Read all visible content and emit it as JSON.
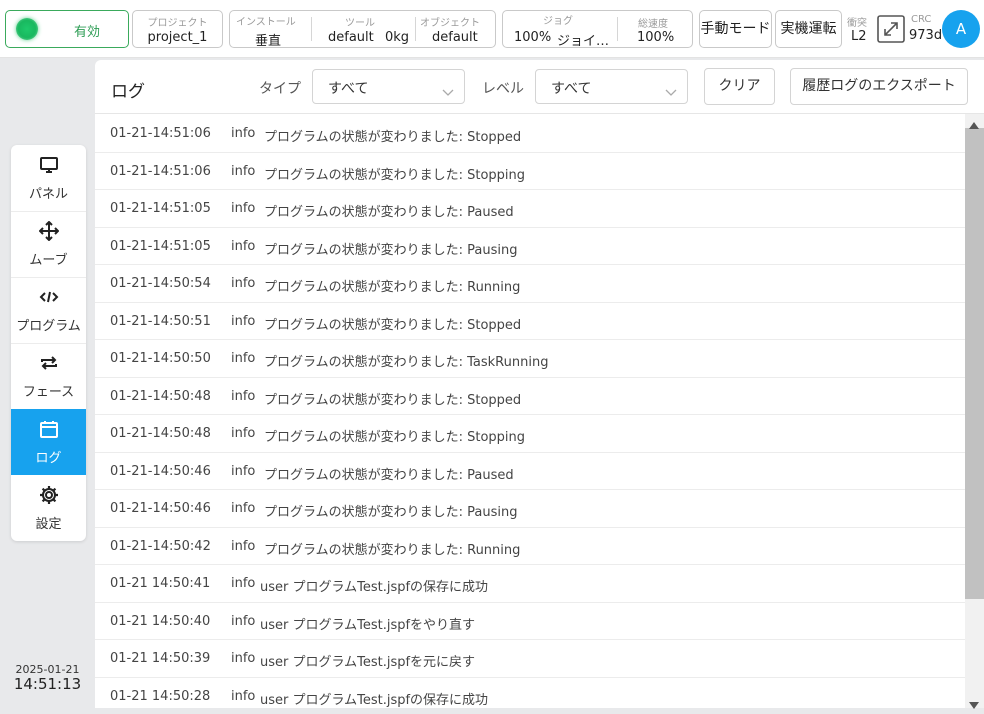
{
  "status": {
    "enable_label": "有効"
  },
  "project": {
    "label": "プロジェクト",
    "value": "project_1"
  },
  "install": {
    "install_label": "インストール",
    "install_value": "垂直",
    "tool_label": "ツール",
    "tool_value": "default",
    "tool_weight": "0kg",
    "object_label": "オブジェクト",
    "object_value": "default"
  },
  "jog": {
    "jog_label": "ジョグ",
    "jog_value": "100%",
    "jog_mode": "ジョイ…",
    "speed_label": "総速度",
    "speed_value": "100%"
  },
  "mode_buttons": {
    "manual": "手動モード",
    "real": "実機運転"
  },
  "collision": {
    "label": "衝突",
    "value": "L2"
  },
  "crc": {
    "label": "CRC",
    "value": "973d"
  },
  "user": {
    "avatar": "A"
  },
  "sidebar": {
    "items": [
      {
        "label": "パネル",
        "icon": "monitor-icon"
      },
      {
        "label": "ムーブ",
        "icon": "move-icon"
      },
      {
        "label": "プログラム",
        "icon": "code-icon"
      },
      {
        "label": "フェース",
        "icon": "repeat-icon"
      },
      {
        "label": "ログ",
        "icon": "calendar-icon"
      },
      {
        "label": "設定",
        "icon": "gear-icon"
      }
    ],
    "active": "ログ"
  },
  "clock": {
    "date": "2025-01-21",
    "time": "14:51:13"
  },
  "log_panel": {
    "title": "ログ",
    "type_label": "タイプ",
    "type_value": "すべて",
    "level_label": "レベル",
    "level_value": "すべて",
    "clear_button": "クリア",
    "export_button": "履歴ログのエクスポート"
  },
  "logs": [
    {
      "time": "01-21-14:51:06",
      "level": "info",
      "message": "プログラムの状態が変わりました: Stopped"
    },
    {
      "time": "01-21-14:51:06",
      "level": "info",
      "message": "プログラムの状態が変わりました: Stopping"
    },
    {
      "time": "01-21-14:51:05",
      "level": "info",
      "message": "プログラムの状態が変わりました: Paused"
    },
    {
      "time": "01-21-14:51:05",
      "level": "info",
      "message": "プログラムの状態が変わりました: Pausing"
    },
    {
      "time": "01-21-14:50:54",
      "level": "info",
      "message": "プログラムの状態が変わりました: Running"
    },
    {
      "time": "01-21-14:50:51",
      "level": "info",
      "message": "プログラムの状態が変わりました: Stopped"
    },
    {
      "time": "01-21-14:50:50",
      "level": "info",
      "message": "プログラムの状態が変わりました: TaskRunning"
    },
    {
      "time": "01-21-14:50:48",
      "level": "info",
      "message": "プログラムの状態が変わりました: Stopped"
    },
    {
      "time": "01-21-14:50:48",
      "level": "info",
      "message": "プログラムの状態が変わりました: Stopping"
    },
    {
      "time": "01-21-14:50:46",
      "level": "info",
      "message": "プログラムの状態が変わりました: Paused"
    },
    {
      "time": "01-21-14:50:46",
      "level": "info",
      "message": "プログラムの状態が変わりました: Pausing"
    },
    {
      "time": "01-21-14:50:42",
      "level": "info",
      "message": "プログラムの状態が変わりました: Running"
    },
    {
      "time": "01-21 14:50:41",
      "level": "info",
      "message": "user プログラムTest.jspfの保存に成功"
    },
    {
      "time": "01-21 14:50:40",
      "level": "info",
      "message": "user プログラムTest.jspfをやり直す"
    },
    {
      "time": "01-21 14:50:39",
      "level": "info",
      "message": "user プログラムTest.jspfを元に戻す"
    },
    {
      "time": "01-21 14:50:28",
      "level": "info",
      "message": "user プログラムTest.jspfの保存に成功"
    }
  ]
}
